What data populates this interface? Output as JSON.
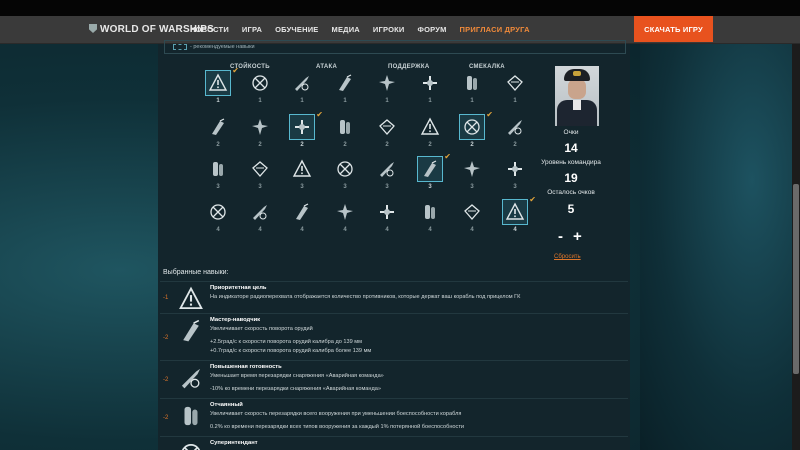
{
  "nav": {
    "logo": "WORLD OF WARSHIPS",
    "items": [
      "НОВОСТИ",
      "ИГРА",
      "ОБУЧЕНИЕ",
      "МЕДИА",
      "ИГРОКИ",
      "ФОРУМ",
      "ПРИГЛАСИ ДРУГА"
    ],
    "download_label": "СКАЧАТЬ ИГРУ"
  },
  "legend": {
    "text": "- рекомендуемые навыки"
  },
  "columns": [
    "СТОЙКОСТЬ",
    "АТАКА",
    "ПОДДЕРЖКА",
    "СМЕКАЛКА"
  ],
  "skill_rows": [
    {
      "costs": [
        "1",
        "1",
        "1",
        "1",
        "1",
        "1",
        "1",
        "1"
      ],
      "selected": [
        true,
        false,
        false,
        false,
        false,
        false,
        false,
        false
      ]
    },
    {
      "costs": [
        "2",
        "2",
        "2",
        "2",
        "2",
        "2",
        "2",
        "2"
      ],
      "selected": [
        false,
        false,
        true,
        false,
        false,
        false,
        true,
        false
      ]
    },
    {
      "costs": [
        "3",
        "3",
        "3",
        "3",
        "3",
        "3",
        "3",
        "3"
      ],
      "selected": [
        false,
        false,
        false,
        false,
        false,
        true,
        false,
        false
      ]
    },
    {
      "costs": [
        "4",
        "4",
        "4",
        "4",
        "4",
        "4",
        "4",
        "4"
      ],
      "selected": [
        false,
        false,
        false,
        false,
        false,
        false,
        false,
        true
      ]
    }
  ],
  "commander": {
    "points_label": "Очки",
    "points": "14",
    "level_label": "Уровень командира",
    "level": "19",
    "remaining_label": "Осталось очков",
    "remaining": "5",
    "minus": "-",
    "plus": "+",
    "reset_label": "Сбросить"
  },
  "selected": {
    "title": "Выбранные навыки:",
    "items": [
      {
        "cost": "-1",
        "name": "Приоритетная цель",
        "lines": [
          "На индикаторе радиоперехвата отображается количество противников, которые держат ваш корабль под прицелом ГК"
        ]
      },
      {
        "cost": "-2",
        "name": "Мастер-наводчик",
        "lines": [
          "Увеличивает скорость поворота орудий",
          "+2.5град/с к скорости поворота орудий калибра до 139 мм",
          "+0.7град/с к скорости поворота орудий калибра более 139 мм"
        ]
      },
      {
        "cost": "-2",
        "name": "Повышенная готовность",
        "lines": [
          "Уменьшает время перезарядки снаряжения «Аварийная команда»",
          "-10% ко времени перезарядки снаряжения «Аварийная команда»"
        ]
      },
      {
        "cost": "-2",
        "name": "Отчаянный",
        "lines": [
          "Увеличивает скорость перезарядки всего вооружения при уменьшении боеспособности корабля",
          "0.2% ко времени перезарядки всех типов вооружения за каждый 1% потерянной боеспособности"
        ]
      },
      {
        "cost": "",
        "name": "Суперинтендант",
        "lines": []
      }
    ]
  }
}
